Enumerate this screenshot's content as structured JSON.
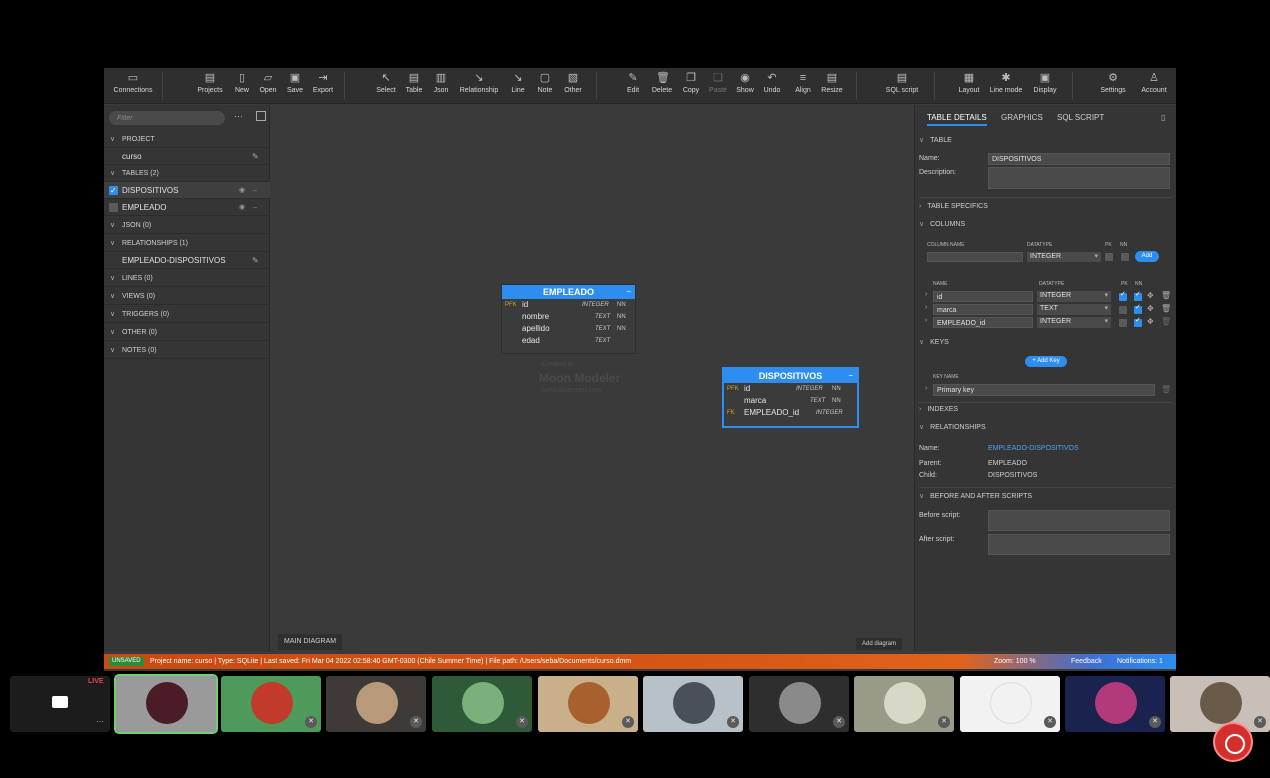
{
  "toolbar": {
    "connections": "Connections",
    "projects": "Projects",
    "new": "New",
    "open": "Open",
    "save": "Save",
    "export": "Export",
    "select": "Select",
    "table": "Table",
    "json": "Json",
    "relationship": "Relationship",
    "line": "Line",
    "note": "Note",
    "other": "Other",
    "edit": "Edit",
    "delete": "Delete",
    "copy": "Copy",
    "paste": "Paste",
    "show": "Show",
    "undo": "Undo",
    "align": "Align",
    "resize": "Resize",
    "sql_script": "SQL script",
    "layout": "Layout",
    "line_mode": "Line mode",
    "display": "Display",
    "settings": "Settings",
    "account": "Account"
  },
  "sidebar": {
    "filter_placeholder": "Filter",
    "more": "···",
    "project_header": "PROJECT",
    "project_name": "curso",
    "tables_header": "TABLES (2)",
    "table_1": "DISPOSITIVOS",
    "table_2": "EMPLEADO",
    "json_header": "JSON (0)",
    "relationships_header": "RELATIONSHIPS (1)",
    "relationship_1": "EMPLEADO-DISPOSITIVOS",
    "lines_header": "LINES (0)",
    "views_header": "VIEWS (0)",
    "triggers_header": "TRIGGERS (0)",
    "other_header": "OTHER (0)",
    "notes_header": "NOTES (0)"
  },
  "canvas": {
    "empleado": {
      "title": "EMPLEADO",
      "rows": [
        {
          "key": "PFK",
          "name": "id",
          "type": "INTEGER",
          "nn": "NN"
        },
        {
          "key": "",
          "name": "nombre",
          "type": "TEXT",
          "nn": "NN"
        },
        {
          "key": "",
          "name": "apellido",
          "type": "TEXT",
          "nn": "NN"
        },
        {
          "key": "",
          "name": "edad",
          "type": "TEXT",
          "nn": ""
        }
      ]
    },
    "dispositivos": {
      "title": "DISPOSITIVOS",
      "rows": [
        {
          "key": "PFK",
          "name": "id",
          "type": "INTEGER",
          "nn": "NN"
        },
        {
          "key": "",
          "name": "marca",
          "type": "TEXT",
          "nn": "NN"
        },
        {
          "key": "FK",
          "name": "EMPLEADO_id",
          "type": "INTEGER",
          "nn": ""
        }
      ]
    },
    "watermark_small": "Created in",
    "watermark_big": "Moon Modeler",
    "watermark_url": "www.datensen.com",
    "diagram_tab": "MAIN DIAGRAM",
    "add_diagram": "Add diagram"
  },
  "rpanel": {
    "tab_details": "TABLE DETAILS",
    "tab_graphics": "GRAPHICS",
    "tab_sql": "SQL SCRIPT",
    "sec_table": "TABLE",
    "name_label": "Name:",
    "name_value": "DISPOSITIVOS",
    "desc_label": "Description:",
    "sec_specifics": "TABLE SPECIFICS",
    "sec_columns": "COLUMNS",
    "col_name_hdr": "COLUMN NAME",
    "datatype_hdr": "DATATYPE",
    "pk_hdr": "PK",
    "nn_hdr": "NN",
    "new_datatype": "INTEGER",
    "add_btn": "Add",
    "name_hdr": "NAME",
    "columns": [
      {
        "name": "id",
        "type": "INTEGER"
      },
      {
        "name": "marca",
        "type": "TEXT"
      },
      {
        "name": "EMPLEADO_id",
        "type": "INTEGER"
      }
    ],
    "sec_keys": "KEYS",
    "add_key": "+ Add Key",
    "key_name_hdr": "KEY NAME",
    "key_1": "Primary key",
    "sec_indexes": "INDEXES",
    "sec_relationships": "RELATIONSHIPS",
    "rel_name_label": "Name:",
    "rel_name_value": "EMPLEADO-DISPOSITIVOS",
    "parent_label": "Parent:",
    "parent_value": "EMPLEADO",
    "child_label": "Child:",
    "child_value": "DISPOSITIVOS",
    "sec_scripts": "BEFORE AND AFTER SCRIPTS",
    "before_label": "Before script:",
    "after_label": "After script:"
  },
  "statusbar": {
    "unsaved": "UNSAVED",
    "text": "Project name: curso   | Type: SQLite  | Last saved: Fri Mar 04 2022 02:58:40 GMT-0300 (Chile Summer Time)   | File path: /Users/seba/Documents/curso.dmm",
    "zoom": "Zoom: 100 %",
    "feedback": "Feedback",
    "notifications": "Notifications: 1"
  },
  "strip": {
    "live": "LIVE"
  },
  "colors": {
    "accent": "#2d8ef0",
    "statusbar_orange": "#d65616",
    "unsaved_green": "#2f8a3a"
  }
}
